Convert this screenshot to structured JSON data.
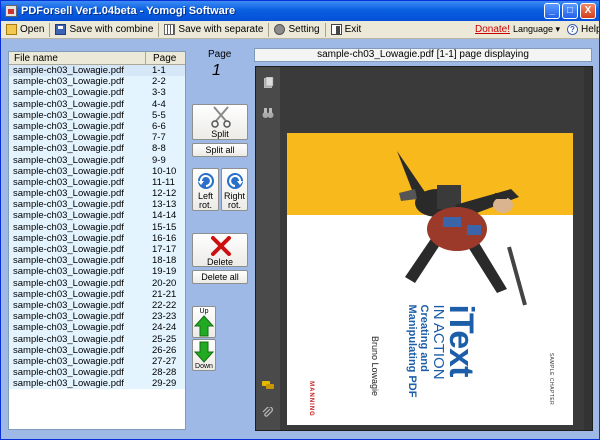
{
  "window": {
    "title": "PDForsell  Ver1.04beta - Yomogi Software"
  },
  "titlebar_buttons": {
    "minimize": "_",
    "maximize": "□",
    "close": "X"
  },
  "toolbar": {
    "open": "Open",
    "save_combine": "Save with combine",
    "save_separate": "Save with separate",
    "setting": "Setting",
    "exit": "Exit",
    "donate": "Donate!",
    "language": "Language ▾",
    "help": "Help"
  },
  "file_list": {
    "header_name": "File name",
    "header_page": "Page",
    "rows": [
      {
        "name": "sample-ch03_Lowagie.pdf",
        "page": "1-1"
      },
      {
        "name": "sample-ch03_Lowagie.pdf",
        "page": "2-2"
      },
      {
        "name": "sample-ch03_Lowagie.pdf",
        "page": "3-3"
      },
      {
        "name": "sample-ch03_Lowagie.pdf",
        "page": "4-4"
      },
      {
        "name": "sample-ch03_Lowagie.pdf",
        "page": "5-5"
      },
      {
        "name": "sample-ch03_Lowagie.pdf",
        "page": "6-6"
      },
      {
        "name": "sample-ch03_Lowagie.pdf",
        "page": "7-7"
      },
      {
        "name": "sample-ch03_Lowagie.pdf",
        "page": "8-8"
      },
      {
        "name": "sample-ch03_Lowagie.pdf",
        "page": "9-9"
      },
      {
        "name": "sample-ch03_Lowagie.pdf",
        "page": "10-10"
      },
      {
        "name": "sample-ch03_Lowagie.pdf",
        "page": "11-11"
      },
      {
        "name": "sample-ch03_Lowagie.pdf",
        "page": "12-12"
      },
      {
        "name": "sample-ch03_Lowagie.pdf",
        "page": "13-13"
      },
      {
        "name": "sample-ch03_Lowagie.pdf",
        "page": "14-14"
      },
      {
        "name": "sample-ch03_Lowagie.pdf",
        "page": "15-15"
      },
      {
        "name": "sample-ch03_Lowagie.pdf",
        "page": "16-16"
      },
      {
        "name": "sample-ch03_Lowagie.pdf",
        "page": "17-17"
      },
      {
        "name": "sample-ch03_Lowagie.pdf",
        "page": "18-18"
      },
      {
        "name": "sample-ch03_Lowagie.pdf",
        "page": "19-19"
      },
      {
        "name": "sample-ch03_Lowagie.pdf",
        "page": "20-20"
      },
      {
        "name": "sample-ch03_Lowagie.pdf",
        "page": "21-21"
      },
      {
        "name": "sample-ch03_Lowagie.pdf",
        "page": "22-22"
      },
      {
        "name": "sample-ch03_Lowagie.pdf",
        "page": "23-23"
      },
      {
        "name": "sample-ch03_Lowagie.pdf",
        "page": "24-24"
      },
      {
        "name": "sample-ch03_Lowagie.pdf",
        "page": "25-25"
      },
      {
        "name": "sample-ch03_Lowagie.pdf",
        "page": "26-26"
      },
      {
        "name": "sample-ch03_Lowagie.pdf",
        "page": "27-27"
      },
      {
        "name": "sample-ch03_Lowagie.pdf",
        "page": "28-28"
      },
      {
        "name": "sample-ch03_Lowagie.pdf",
        "page": "29-29"
      }
    ]
  },
  "page_indicator": {
    "label": "Page",
    "value": "1"
  },
  "buttons": {
    "split": "Split",
    "split_all": "Split all",
    "left_rot_1": "Left",
    "left_rot_2": "rot.",
    "right_rot_1": "Right",
    "right_rot_2": "rot.",
    "delete": "Delete",
    "delete_all": "Delete all",
    "up": "Up",
    "down": "Down"
  },
  "viewer": {
    "title": "sample-ch03_Lowagie.pdf   [1-1] page displaying"
  },
  "cover": {
    "brand": "iText",
    "subtitle": "IN ACTION",
    "line1": "Creating and",
    "line2": "Manipulating PDF",
    "author": "Bruno Lowagie",
    "publisher": "MANNING",
    "sample": "SAMPLE CHAPTER"
  },
  "colors": {
    "accent": "#0550d8",
    "delete_red": "#cc1111",
    "arrow_green": "#22aa22",
    "cover_yellow": "#f7b91c",
    "cover_blue": "#1d5ea8"
  }
}
